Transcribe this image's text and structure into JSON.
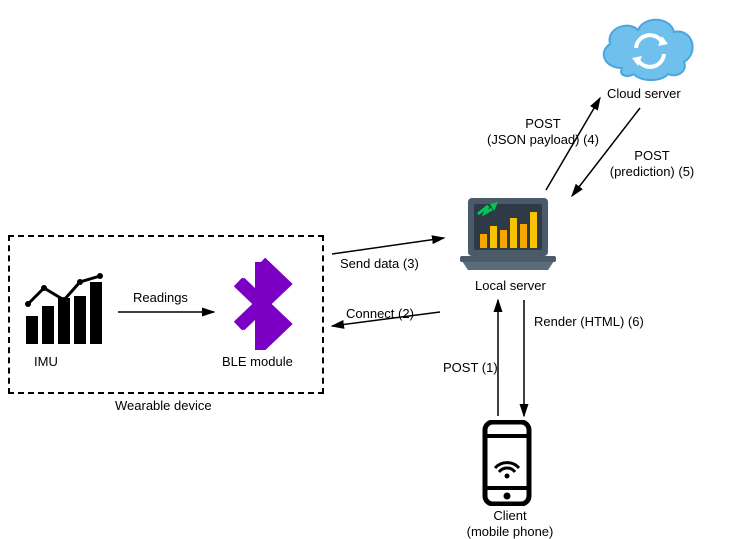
{
  "wearable": {
    "box_label": "Wearable device",
    "imu_label": "IMU",
    "ble_label": "BLE module",
    "readings_label": "Readings"
  },
  "flows": {
    "send_data": "Send data (3)",
    "connect": "Connect (2)",
    "post1": "POST (1)",
    "render": "Render (HTML) (6)",
    "post_json": "POST",
    "post_json_line2": "(JSON payload) (4)",
    "post_pred": "POST",
    "post_pred_line2": "(prediction) (5)"
  },
  "nodes": {
    "local_server": "Local server",
    "cloud_server": "Cloud server",
    "client_line1": "Client",
    "client_line2": "(mobile phone)"
  },
  "colors": {
    "bluetooth": "#7b00c4",
    "cloud_fill": "#5fb4e6",
    "laptop_body": "#4a5a68",
    "laptop_screen": "#2e3b47",
    "bar_orange": "#f7a600",
    "bar_yellow": "#f9c200",
    "arrow_green": "#00c853"
  }
}
